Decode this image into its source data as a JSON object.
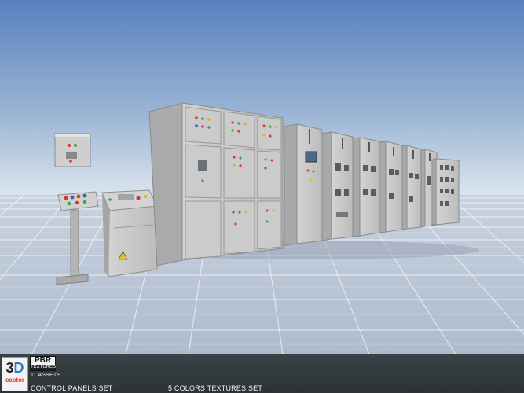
{
  "banner": {
    "logo_line1": "3",
    "logo_line1_accent": "D",
    "logo_line2": "castor",
    "badge_title": "PBR",
    "badge_subtitle": "TEXTURES",
    "assets_count": "11 ASSETS",
    "set_title": "CONTROL PANELS SET",
    "textures_note": "5 COLORS TEXTURES SET"
  },
  "colors": {
    "sky_top": "#5c84c0",
    "sky_horizon": "#d6e1ec",
    "floor": "#b9c4d4",
    "grid_line": "#f4f7fb",
    "cabinet": "#c9c9c8",
    "cabinet_shade": "#9a9b9c",
    "banner": "#30383b"
  }
}
